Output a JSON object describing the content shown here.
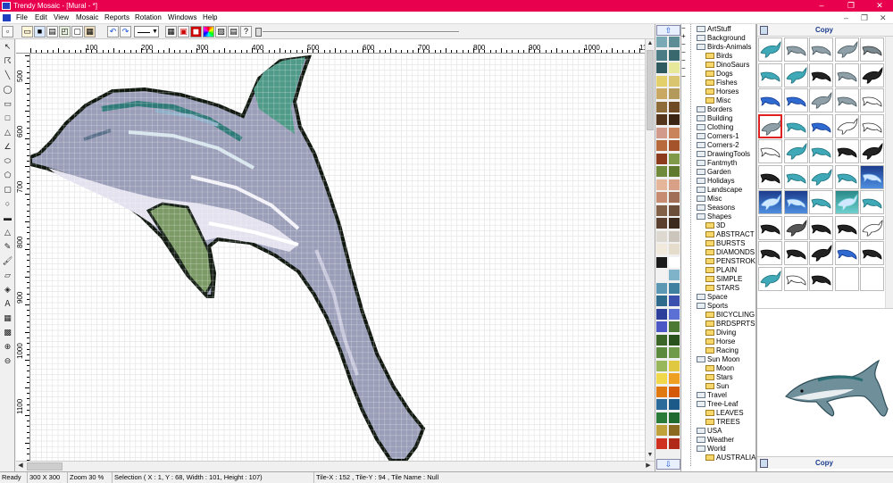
{
  "window": {
    "title": "Trendy Mosaic - [Mural - *]",
    "controls": [
      "–",
      "❐",
      "✕"
    ]
  },
  "menu": [
    "File",
    "Edit",
    "View",
    "Mosaic",
    "Reports",
    "Rotation",
    "Windows",
    "Help"
  ],
  "mdi_controls": [
    "–",
    "❐",
    "✕"
  ],
  "toolbar": {
    "buttons": [
      "new-icon",
      "open-icon",
      "save-icon",
      "print-icon",
      "undo-icon",
      "redo-icon",
      "line-style-select",
      "grid-icon",
      "tile-icon",
      "color-wheel-icon",
      "color-icon",
      "image-icon",
      "settings-icon"
    ],
    "undo_glyph": "↶",
    "redo_glyph": "↷"
  },
  "ruler": {
    "h_labels": [
      "100",
      "200",
      "300",
      "400",
      "500",
      "600",
      "700",
      "800",
      "900",
      "1000",
      "11"
    ],
    "v_labels": [
      "500",
      "600",
      "700",
      "800",
      "900",
      "1000",
      "1100"
    ]
  },
  "palette": {
    "up": "⇧",
    "down": "⇩",
    "colors": [
      "#7aa9b6",
      "#5e8e95",
      "#4b7b84",
      "#39686f",
      "#2e5a60",
      "#e7e89a",
      "#e3d06a",
      "#d9c470",
      "#c9a861",
      "#b39a5a",
      "#8f6b3a",
      "#6f4a25",
      "#55351b",
      "#3b2512",
      "#d29a8a",
      "#c9845c",
      "#b86a3c",
      "#a4532a",
      "#8c3b1d",
      "#7f9a49",
      "#6f8a3b",
      "#5f7a2e",
      "#e6b69b",
      "#d8a086",
      "#c78b71",
      "#a16f57",
      "#826047",
      "#6c4f3b",
      "#5a3f2e",
      "#3c2a1f",
      "#ded9d0",
      "#cbc5bb",
      "#f0e9dc",
      "#e6dccb",
      "#1a1a1a",
      "#ffffff",
      "#f2f2f2",
      "#7eb3c9",
      "#5c98b3",
      "#3f7f9f",
      "#2d6a8c",
      "#3a4fae",
      "#2c3f9a",
      "#5c6fd4",
      "#4a57c4",
      "#4c7a34",
      "#3b6628",
      "#2a521c",
      "#5c8a3c",
      "#6e9a4a",
      "#98b65a",
      "#e0c840",
      "#f0d84a",
      "#f0a020",
      "#e07a10",
      "#d45a0a",
      "#2a6a9a",
      "#1c5a8a",
      "#2a7a3a",
      "#1f6a2e",
      "#bfa33a",
      "#8a6a20",
      "#d03020",
      "#b02818"
    ]
  },
  "tree": {
    "items": [
      {
        "label": "ArtStuff",
        "level": 1,
        "expander": "",
        "folder": "open"
      },
      {
        "label": "Background",
        "level": 1,
        "expander": "",
        "folder": "open"
      },
      {
        "label": "Birds-Animals",
        "level": 1,
        "expander": "−",
        "folder": "open"
      },
      {
        "label": "Birds",
        "level": 2,
        "expander": "",
        "folder": "closed"
      },
      {
        "label": "DinoSaurs",
        "level": 2,
        "expander": "",
        "folder": "closed"
      },
      {
        "label": "Dogs",
        "level": 2,
        "expander": "",
        "folder": "closed"
      },
      {
        "label": "Fishes",
        "level": 2,
        "expander": "",
        "folder": "closed"
      },
      {
        "label": "Horses",
        "level": 2,
        "expander": "",
        "folder": "closed"
      },
      {
        "label": "Misc",
        "level": 2,
        "expander": "",
        "folder": "closed"
      },
      {
        "label": "Borders",
        "level": 1,
        "expander": "",
        "folder": "open"
      },
      {
        "label": "Building",
        "level": 1,
        "expander": "",
        "folder": "open"
      },
      {
        "label": "Clothing",
        "level": 1,
        "expander": "",
        "folder": "open"
      },
      {
        "label": "Corners-1",
        "level": 1,
        "expander": "",
        "folder": "open"
      },
      {
        "label": "Corners-2",
        "level": 1,
        "expander": "",
        "folder": "open"
      },
      {
        "label": "DrawingTools",
        "level": 1,
        "expander": "",
        "folder": "open"
      },
      {
        "label": "Fantmyth",
        "level": 1,
        "expander": "",
        "folder": "open"
      },
      {
        "label": "Garden",
        "level": 1,
        "expander": "",
        "folder": "open"
      },
      {
        "label": "Holidays",
        "level": 1,
        "expander": "+",
        "folder": "open"
      },
      {
        "label": "Landscape",
        "level": 1,
        "expander": "",
        "folder": "open"
      },
      {
        "label": "Misc",
        "level": 1,
        "expander": "",
        "folder": "open"
      },
      {
        "label": "Seasons",
        "level": 1,
        "expander": "",
        "folder": "open"
      },
      {
        "label": "Shapes",
        "level": 1,
        "expander": "−",
        "folder": "open"
      },
      {
        "label": "3D",
        "level": 2,
        "expander": "",
        "folder": "closed"
      },
      {
        "label": "ABSTRACT",
        "level": 2,
        "expander": "",
        "folder": "closed"
      },
      {
        "label": "BURSTS",
        "level": 2,
        "expander": "",
        "folder": "closed"
      },
      {
        "label": "DIAMONDS",
        "level": 2,
        "expander": "",
        "folder": "closed"
      },
      {
        "label": "PENSTROKES",
        "level": 2,
        "expander": "",
        "folder": "closed"
      },
      {
        "label": "PLAIN",
        "level": 2,
        "expander": "",
        "folder": "closed"
      },
      {
        "label": "SIMPLE",
        "level": 2,
        "expander": "",
        "folder": "closed"
      },
      {
        "label": "STARS",
        "level": 2,
        "expander": "",
        "folder": "closed"
      },
      {
        "label": "Space",
        "level": 1,
        "expander": "",
        "folder": "open"
      },
      {
        "label": "Sports",
        "level": 1,
        "expander": "−",
        "folder": "open"
      },
      {
        "label": "BICYCLING",
        "level": 2,
        "expander": "",
        "folder": "closed"
      },
      {
        "label": "BRDSPRTS",
        "level": 2,
        "expander": "",
        "folder": "closed"
      },
      {
        "label": "Diving",
        "level": 2,
        "expander": "",
        "folder": "closed"
      },
      {
        "label": "Horse",
        "level": 2,
        "expander": "",
        "folder": "closed"
      },
      {
        "label": "Racing",
        "level": 2,
        "expander": "",
        "folder": "closed"
      },
      {
        "label": "Sun Moon",
        "level": 1,
        "expander": "−",
        "folder": "open"
      },
      {
        "label": "Moon",
        "level": 2,
        "expander": "",
        "folder": "closed"
      },
      {
        "label": "Stars",
        "level": 2,
        "expander": "",
        "folder": "closed"
      },
      {
        "label": "Sun",
        "level": 2,
        "expander": "",
        "folder": "closed"
      },
      {
        "label": "Travel",
        "level": 1,
        "expander": "",
        "folder": "open"
      },
      {
        "label": "Tree-Leaf",
        "level": 1,
        "expander": "−",
        "folder": "open"
      },
      {
        "label": "LEAVES",
        "level": 2,
        "expander": "",
        "folder": "closed"
      },
      {
        "label": "TREES",
        "level": 2,
        "expander": "",
        "folder": "closed"
      },
      {
        "label": "USA",
        "level": 1,
        "expander": "",
        "folder": "open"
      },
      {
        "label": "Weather",
        "level": 1,
        "expander": "",
        "folder": "open"
      },
      {
        "label": "World",
        "level": 1,
        "expander": "−",
        "folder": "open"
      },
      {
        "label": "AUSTRALIA",
        "level": 2,
        "expander": "",
        "folder": "closed"
      }
    ]
  },
  "right_panel": {
    "copy_label_top": "Copy",
    "copy_label_bottom": "Copy",
    "thumb_count": 50,
    "selected_thumb": 15,
    "thumb_kinds": [
      "dolphin-teal",
      "dolphin-grey",
      "dolphin-grey",
      "dolphin-grey",
      "shark-grey",
      "dolphin-teal",
      "dolphin-teal",
      "dolphin-black",
      "dolphin-grey",
      "dolphin-black",
      "dolphin-blue",
      "dolphin-blue",
      "dolphin-grey",
      "dolphin-grey",
      "dolphin-outline",
      "dolphin-grey",
      "dolphin-teal",
      "dolphin-blue",
      "dolphin-outline",
      "dolphin-outline",
      "dolphin-outline",
      "dolphin-teal",
      "dolphin-teal",
      "dolphin-black",
      "dolphin-black",
      "dolphin-black",
      "dolphin-teal",
      "dolphin-teal",
      "dolphin-teal",
      "scene-blue",
      "scene-blue",
      "scene-blue",
      "dolphin-teal",
      "scene-teal",
      "dolphin-teal",
      "dolphin-black",
      "seal-grey",
      "dolphin-black",
      "dolphin-black",
      "dolphin-outline",
      "dolphin-black",
      "dolphin-black",
      "dolphin-black",
      "dolphin-blue",
      "dolphin-black",
      "dolphin-teal",
      "dolphin-outline",
      "dolphin-black",
      "blank",
      "blank"
    ]
  },
  "status": {
    "ready": "Ready",
    "size": "300 X 300",
    "zoom": "Zoom 30 %",
    "selection": "Selection ( X : 1, Y : 68, Width : 101, Height : 107)",
    "tile": "Tile-X : 152 , Tile-Y : 94 , Tile Name : Null"
  }
}
